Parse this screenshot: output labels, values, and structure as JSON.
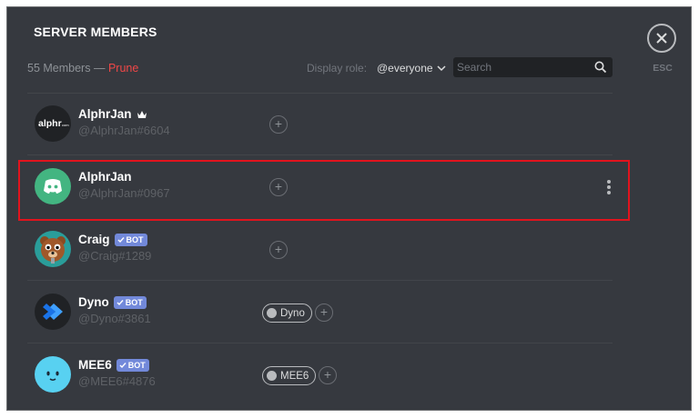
{
  "header": {
    "title": "SERVER MEMBERS",
    "member_count": "55 Members —",
    "prune_label": "Prune",
    "display_role_label": "Display role:",
    "display_role_value": "@everyone",
    "search_placeholder": "Search",
    "esc_label": "ESC"
  },
  "members": [
    {
      "name": "AlphrJan",
      "tag": "@AlphrJan#6604",
      "owner": true,
      "bot": false,
      "avatar_text": "alphr",
      "avatar_subtext": "com",
      "roles": []
    },
    {
      "name": "AlphrJan",
      "tag": "@AlphrJan#0967",
      "owner": false,
      "bot": false,
      "roles": []
    },
    {
      "name": "Craig",
      "tag": "@Craig#1289",
      "bot": true,
      "bot_label": "BOT",
      "roles": []
    },
    {
      "name": "Dyno",
      "tag": "@Dyno#3861",
      "bot": true,
      "bot_label": "BOT",
      "roles": [
        "Dyno"
      ]
    },
    {
      "name": "MEE6",
      "tag": "@MEE6#4876",
      "bot": true,
      "bot_label": "BOT",
      "roles": [
        "MEE6"
      ]
    }
  ],
  "colors": {
    "background": "#36393f",
    "accent_blurple": "#7289da",
    "prune_red": "#f04747",
    "highlight_red": "#e2131d",
    "discord_green": "#43b581",
    "mee6_cyan": "#58d1f1"
  },
  "add_role_symbol": "+",
  "icons": [
    "close-icon",
    "search-icon",
    "chevron-down-icon",
    "crown-icon",
    "checkmark-icon",
    "more-vertical-icon",
    "discord-logo-icon",
    "craig-bear-icon",
    "dyno-logo-icon",
    "mee6-face-icon"
  ]
}
